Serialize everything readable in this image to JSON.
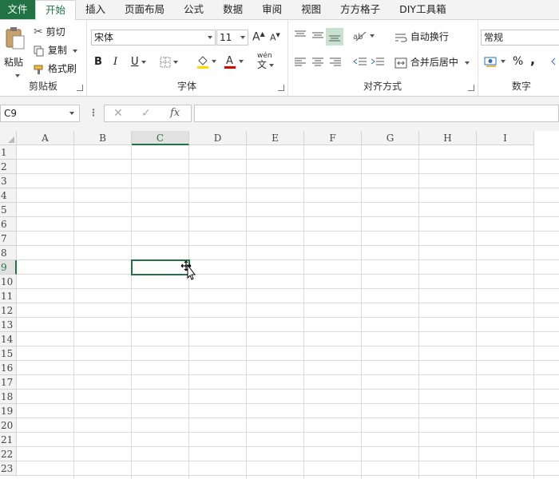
{
  "tabs": [
    "文件",
    "开始",
    "插入",
    "页面布局",
    "公式",
    "数据",
    "审阅",
    "视图",
    "方方格子",
    "DIY工具箱"
  ],
  "active_tab": "开始",
  "clipboard": {
    "paste": "粘贴",
    "cut": "剪切",
    "copy": "复制",
    "format_painter": "格式刷",
    "group": "剪贴板"
  },
  "font": {
    "name": "宋体",
    "size": "11",
    "group": "字体",
    "bold": "B",
    "italic": "I",
    "underline": "U",
    "increase": "A",
    "decrease": "A",
    "phonetic": "wén",
    "phonetic_char": "文"
  },
  "alignment": {
    "wrap": "自动换行",
    "merge": "合并后居中",
    "group": "对齐方式"
  },
  "number": {
    "format": "常规",
    "group": "数字",
    "percent": "%",
    "comma": ","
  },
  "formula_bar": {
    "name_box": "C9",
    "cancel": "✕",
    "confirm": "✓",
    "fx": "fx",
    "value": ""
  },
  "columns": [
    "A",
    "B",
    "C",
    "D",
    "E",
    "F",
    "G",
    "H",
    "I"
  ],
  "rows": [
    "1",
    "2",
    "3",
    "4",
    "5",
    "6",
    "7",
    "8",
    "9",
    "10",
    "11",
    "12",
    "13",
    "14",
    "15",
    "16",
    "17",
    "18",
    "19",
    "20",
    "21",
    "22",
    "23"
  ],
  "selected_cell": "C9",
  "colors": {
    "accent": "#217346",
    "font_color": "#e00000",
    "fill_color": "#ffd800"
  }
}
